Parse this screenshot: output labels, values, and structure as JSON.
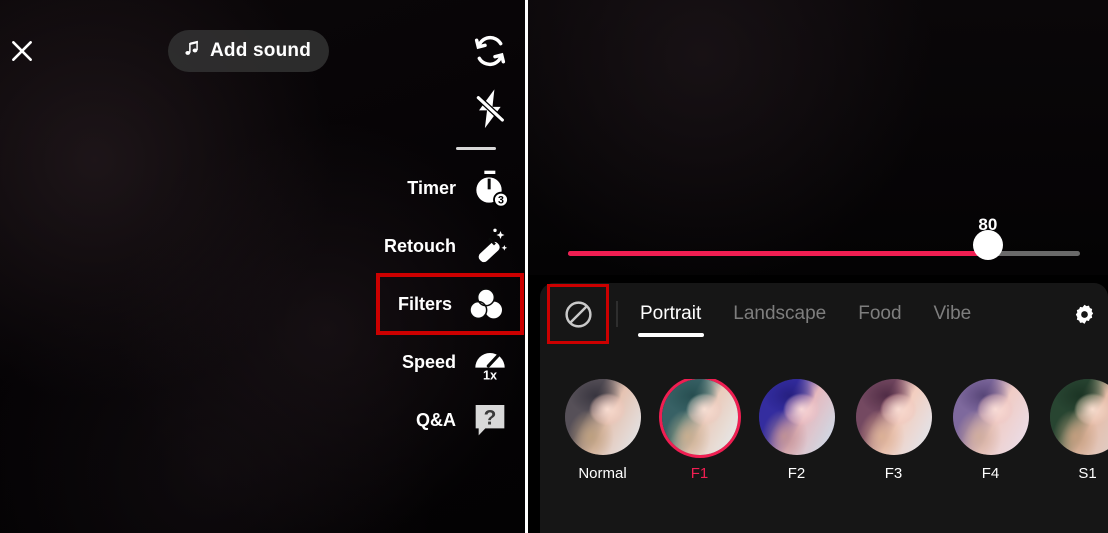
{
  "camera": {
    "close_icon": "close-x-icon",
    "add_sound": {
      "label": "Add sound",
      "icon": "music-note-icon"
    },
    "tools": [
      {
        "id": "flip",
        "label": "",
        "icon": "flip-camera-icon",
        "highlighted": false
      },
      {
        "id": "flash",
        "label": "",
        "icon": "flash-off-icon",
        "highlighted": false
      },
      {
        "id": "timer",
        "label": "Timer",
        "icon": "timer-3s-icon",
        "highlighted": false
      },
      {
        "id": "retouch",
        "label": "Retouch",
        "icon": "magic-wand-icon",
        "highlighted": false
      },
      {
        "id": "filters",
        "label": "Filters",
        "icon": "filters-circles-icon",
        "highlighted": true
      },
      {
        "id": "speed",
        "label": "Speed",
        "icon": "speedometer-1x-icon",
        "highlighted": false
      },
      {
        "id": "qa",
        "label": "Q&A",
        "icon": "question-bubble-icon",
        "highlighted": false
      }
    ]
  },
  "filter_panel": {
    "intensity": {
      "value": "80",
      "percent": 82,
      "fill_color": "#f01e52",
      "track_color": "#6a6a6a"
    },
    "no_filter_icon": "no-filter-prohibition-icon",
    "settings_icon": "gear-icon",
    "tabs": [
      {
        "label": "Portrait",
        "active": true
      },
      {
        "label": "Landscape",
        "active": false
      },
      {
        "label": "Food",
        "active": false
      },
      {
        "label": "Vibe",
        "active": false
      }
    ],
    "filters": [
      {
        "name": "Normal",
        "selected": false
      },
      {
        "name": "F1",
        "selected": true
      },
      {
        "name": "F2",
        "selected": false
      },
      {
        "name": "F3",
        "selected": false
      },
      {
        "name": "F4",
        "selected": false
      },
      {
        "name": "S1",
        "selected": false
      }
    ],
    "selected_color": "#f01e52"
  },
  "annotation": {
    "highlight_color": "#cc0000"
  }
}
